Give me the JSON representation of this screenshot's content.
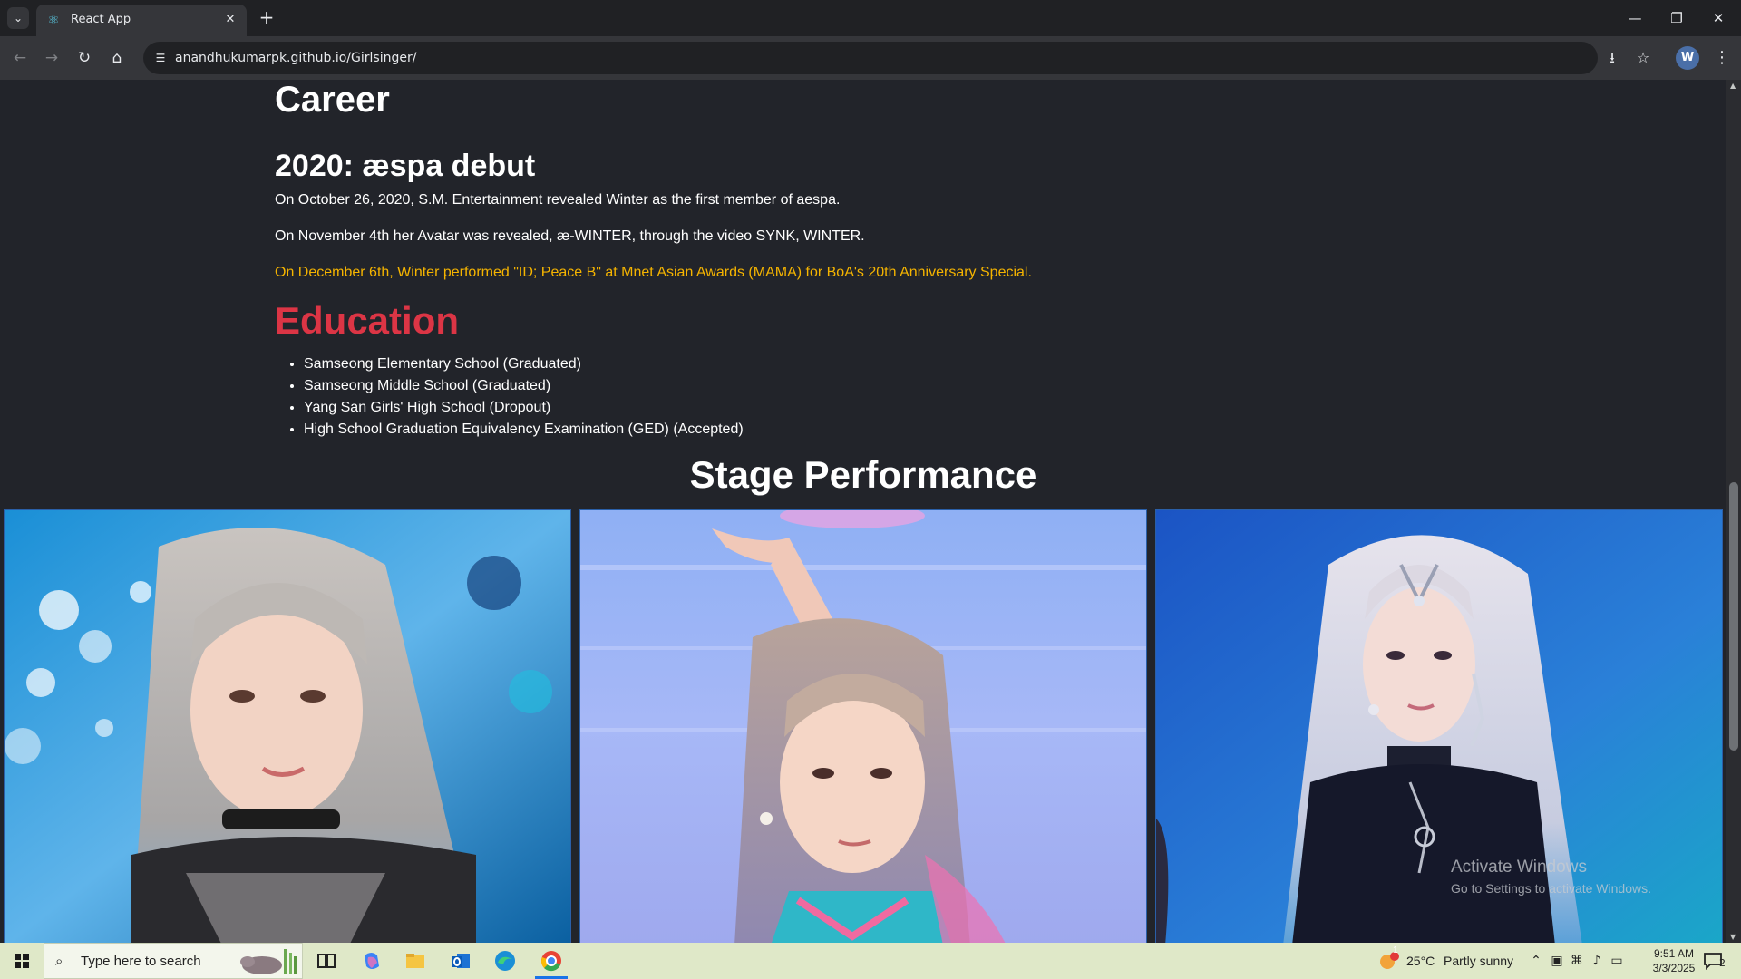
{
  "browser": {
    "tab_title": "React App",
    "url": "anandhukumarpk.github.io/Girlsinger/"
  },
  "page": {
    "career_heading": "Career",
    "debut_heading": "2020: æspa debut",
    "paragraphs": [
      "On October 26, 2020, S.M. Entertainment revealed Winter as the first member of aespa.",
      "On November 4th her Avatar was revealed, æ-WINTER, through the video SYNK, WINTER.",
      "On December 6th, Winter performed \"ID; Peace B\" at Mnet Asian Awards (MAMA) for BoA's 20th Anniversary Special."
    ],
    "highlight_color": "#f5b400",
    "education_heading": "Education",
    "education_color": "#dc3545",
    "education_items": [
      "Samseong Elementary School (Graduated)",
      "Samseong Middle School (Graduated)",
      "Yang San Girls' High School (Dropout)",
      "High School Graduation Equivalency Examination (GED) (Accepted)"
    ],
    "stage_heading": "Stage Performance"
  },
  "watermark": {
    "title": "Activate Windows",
    "subtitle": "Go to Settings to activate Windows."
  },
  "taskbar": {
    "search_placeholder": "Type here to search",
    "weather_temp": "25°C",
    "weather_desc": "Partly sunny",
    "weather_badge": "1",
    "time": "9:51 AM",
    "date": "3/3/2025",
    "notification_count": "2"
  }
}
